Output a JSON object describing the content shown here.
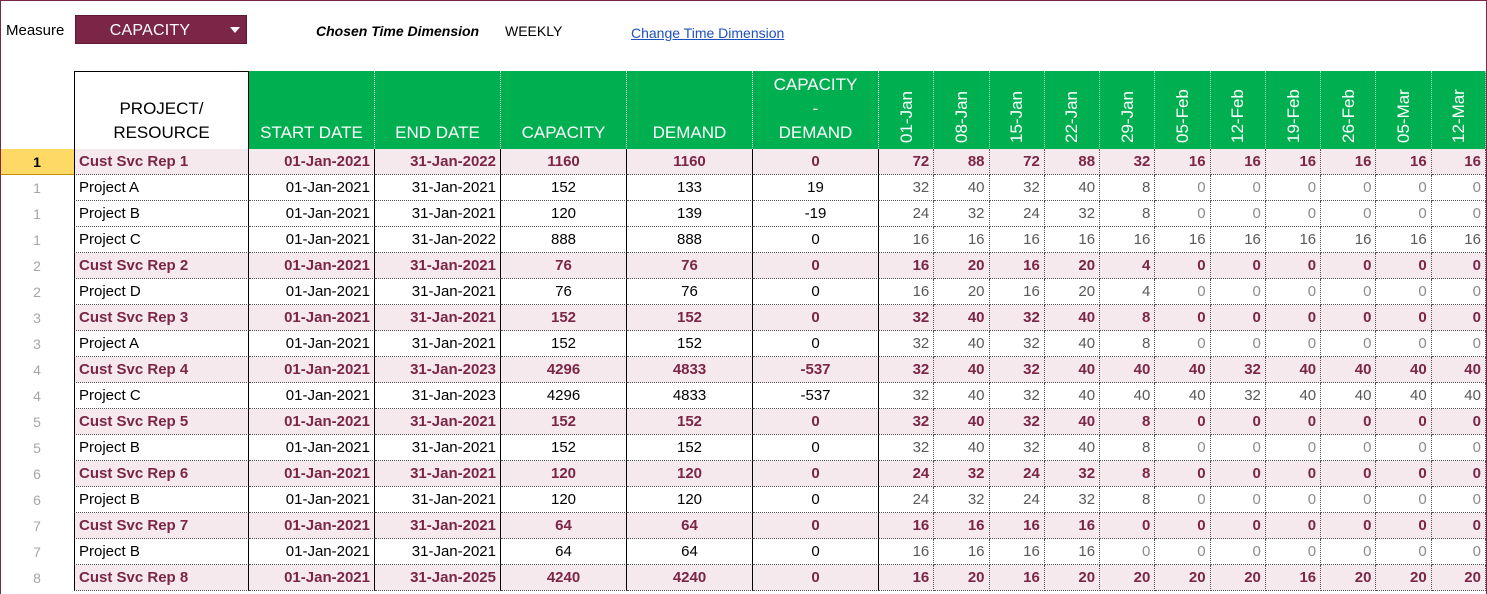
{
  "toolbar": {
    "measure_label": "Measure",
    "measure_value": "CAPACITY",
    "time_dimension_label": "Chosen Time Dimension",
    "time_dimension_value": "WEEKLY",
    "change_link": "Change Time Dimension"
  },
  "colors": {
    "header_green": "#00b050",
    "summary_fg": "#7b2547",
    "summary_bg": "#f6e9ee",
    "active_row": "#ffd966",
    "link": "#1f4fbf"
  },
  "table": {
    "headers": {
      "project": [
        "PROJECT/",
        "RESOURCE"
      ],
      "start": "START DATE",
      "end": "END DATE",
      "capacity": "CAPACITY",
      "demand": "DEMAND",
      "cap_minus_dem": [
        "CAPACITY",
        "-",
        "DEMAND"
      ]
    },
    "weeks": [
      "01-Jan",
      "08-Jan",
      "15-Jan",
      "22-Jan",
      "29-Jan",
      "05-Feb",
      "12-Feb",
      "19-Feb",
      "26-Feb",
      "05-Mar",
      "12-Mar"
    ],
    "rows": [
      {
        "num": "1",
        "type": "summary",
        "active": true,
        "name": "Cust Svc Rep 1",
        "start": "01-Jan-2021",
        "end": "31-Jan-2022",
        "capacity": "1160",
        "demand": "1160",
        "diff": "0",
        "weeks": [
          "72",
          "88",
          "72",
          "88",
          "32",
          "16",
          "16",
          "16",
          "16",
          "16",
          "16"
        ]
      },
      {
        "num": "1",
        "type": "detail",
        "name": "Project A",
        "start": "01-Jan-2021",
        "end": "31-Jan-2021",
        "capacity": "152",
        "demand": "133",
        "diff": "19",
        "weeks": [
          "32",
          "40",
          "32",
          "40",
          "8",
          "0",
          "0",
          "0",
          "0",
          "0",
          "0"
        ]
      },
      {
        "num": "1",
        "type": "detail",
        "name": "Project B",
        "start": "01-Jan-2021",
        "end": "31-Jan-2021",
        "capacity": "120",
        "demand": "139",
        "diff": "-19",
        "weeks": [
          "24",
          "32",
          "24",
          "32",
          "8",
          "0",
          "0",
          "0",
          "0",
          "0",
          "0"
        ]
      },
      {
        "num": "1",
        "type": "detail",
        "name": "Project C",
        "start": "01-Jan-2021",
        "end": "31-Jan-2022",
        "capacity": "888",
        "demand": "888",
        "diff": "0",
        "weeks": [
          "16",
          "16",
          "16",
          "16",
          "16",
          "16",
          "16",
          "16",
          "16",
          "16",
          "16"
        ]
      },
      {
        "num": "2",
        "type": "summary",
        "name": "Cust Svc Rep 2",
        "start": "01-Jan-2021",
        "end": "31-Jan-2021",
        "capacity": "76",
        "demand": "76",
        "diff": "0",
        "weeks": [
          "16",
          "20",
          "16",
          "20",
          "4",
          "0",
          "0",
          "0",
          "0",
          "0",
          "0"
        ]
      },
      {
        "num": "2",
        "type": "detail",
        "name": "Project D",
        "start": "01-Jan-2021",
        "end": "31-Jan-2021",
        "capacity": "76",
        "demand": "76",
        "diff": "0",
        "weeks": [
          "16",
          "20",
          "16",
          "20",
          "4",
          "0",
          "0",
          "0",
          "0",
          "0",
          "0"
        ]
      },
      {
        "num": "3",
        "type": "summary",
        "name": "Cust Svc Rep 3",
        "start": "01-Jan-2021",
        "end": "31-Jan-2021",
        "capacity": "152",
        "demand": "152",
        "diff": "0",
        "weeks": [
          "32",
          "40",
          "32",
          "40",
          "8",
          "0",
          "0",
          "0",
          "0",
          "0",
          "0"
        ]
      },
      {
        "num": "3",
        "type": "detail",
        "name": "Project A",
        "start": "01-Jan-2021",
        "end": "31-Jan-2021",
        "capacity": "152",
        "demand": "152",
        "diff": "0",
        "weeks": [
          "32",
          "40",
          "32",
          "40",
          "8",
          "0",
          "0",
          "0",
          "0",
          "0",
          "0"
        ]
      },
      {
        "num": "4",
        "type": "summary",
        "name": "Cust Svc Rep 4",
        "start": "01-Jan-2021",
        "end": "31-Jan-2023",
        "capacity": "4296",
        "demand": "4833",
        "diff": "-537",
        "weeks": [
          "32",
          "40",
          "32",
          "40",
          "40",
          "40",
          "32",
          "40",
          "40",
          "40",
          "40"
        ]
      },
      {
        "num": "4",
        "type": "detail",
        "name": "Project C",
        "start": "01-Jan-2021",
        "end": "31-Jan-2023",
        "capacity": "4296",
        "demand": "4833",
        "diff": "-537",
        "weeks": [
          "32",
          "40",
          "32",
          "40",
          "40",
          "40",
          "32",
          "40",
          "40",
          "40",
          "40"
        ]
      },
      {
        "num": "5",
        "type": "summary",
        "name": "Cust Svc Rep 5",
        "start": "01-Jan-2021",
        "end": "31-Jan-2021",
        "capacity": "152",
        "demand": "152",
        "diff": "0",
        "weeks": [
          "32",
          "40",
          "32",
          "40",
          "8",
          "0",
          "0",
          "0",
          "0",
          "0",
          "0"
        ]
      },
      {
        "num": "5",
        "type": "detail",
        "name": "Project B",
        "start": "01-Jan-2021",
        "end": "31-Jan-2021",
        "capacity": "152",
        "demand": "152",
        "diff": "0",
        "weeks": [
          "32",
          "40",
          "32",
          "40",
          "8",
          "0",
          "0",
          "0",
          "0",
          "0",
          "0"
        ]
      },
      {
        "num": "6",
        "type": "summary",
        "name": "Cust Svc Rep 6",
        "start": "01-Jan-2021",
        "end": "31-Jan-2021",
        "capacity": "120",
        "demand": "120",
        "diff": "0",
        "weeks": [
          "24",
          "32",
          "24",
          "32",
          "8",
          "0",
          "0",
          "0",
          "0",
          "0",
          "0"
        ]
      },
      {
        "num": "6",
        "type": "detail",
        "name": "Project B",
        "start": "01-Jan-2021",
        "end": "31-Jan-2021",
        "capacity": "120",
        "demand": "120",
        "diff": "0",
        "weeks": [
          "24",
          "32",
          "24",
          "32",
          "8",
          "0",
          "0",
          "0",
          "0",
          "0",
          "0"
        ]
      },
      {
        "num": "7",
        "type": "summary",
        "name": "Cust Svc Rep 7",
        "start": "01-Jan-2021",
        "end": "31-Jan-2021",
        "capacity": "64",
        "demand": "64",
        "diff": "0",
        "weeks": [
          "16",
          "16",
          "16",
          "16",
          "0",
          "0",
          "0",
          "0",
          "0",
          "0",
          "0"
        ]
      },
      {
        "num": "7",
        "type": "detail",
        "name": "Project B",
        "start": "01-Jan-2021",
        "end": "31-Jan-2021",
        "capacity": "64",
        "demand": "64",
        "diff": "0",
        "weeks": [
          "16",
          "16",
          "16",
          "16",
          "0",
          "0",
          "0",
          "0",
          "0",
          "0",
          "0"
        ]
      },
      {
        "num": "8",
        "type": "summary",
        "name": "Cust Svc Rep 8",
        "start": "01-Jan-2021",
        "end": "31-Jan-2025",
        "capacity": "4240",
        "demand": "4240",
        "diff": "0",
        "weeks": [
          "16",
          "20",
          "16",
          "20",
          "20",
          "20",
          "20",
          "16",
          "20",
          "20",
          "20"
        ]
      }
    ]
  }
}
